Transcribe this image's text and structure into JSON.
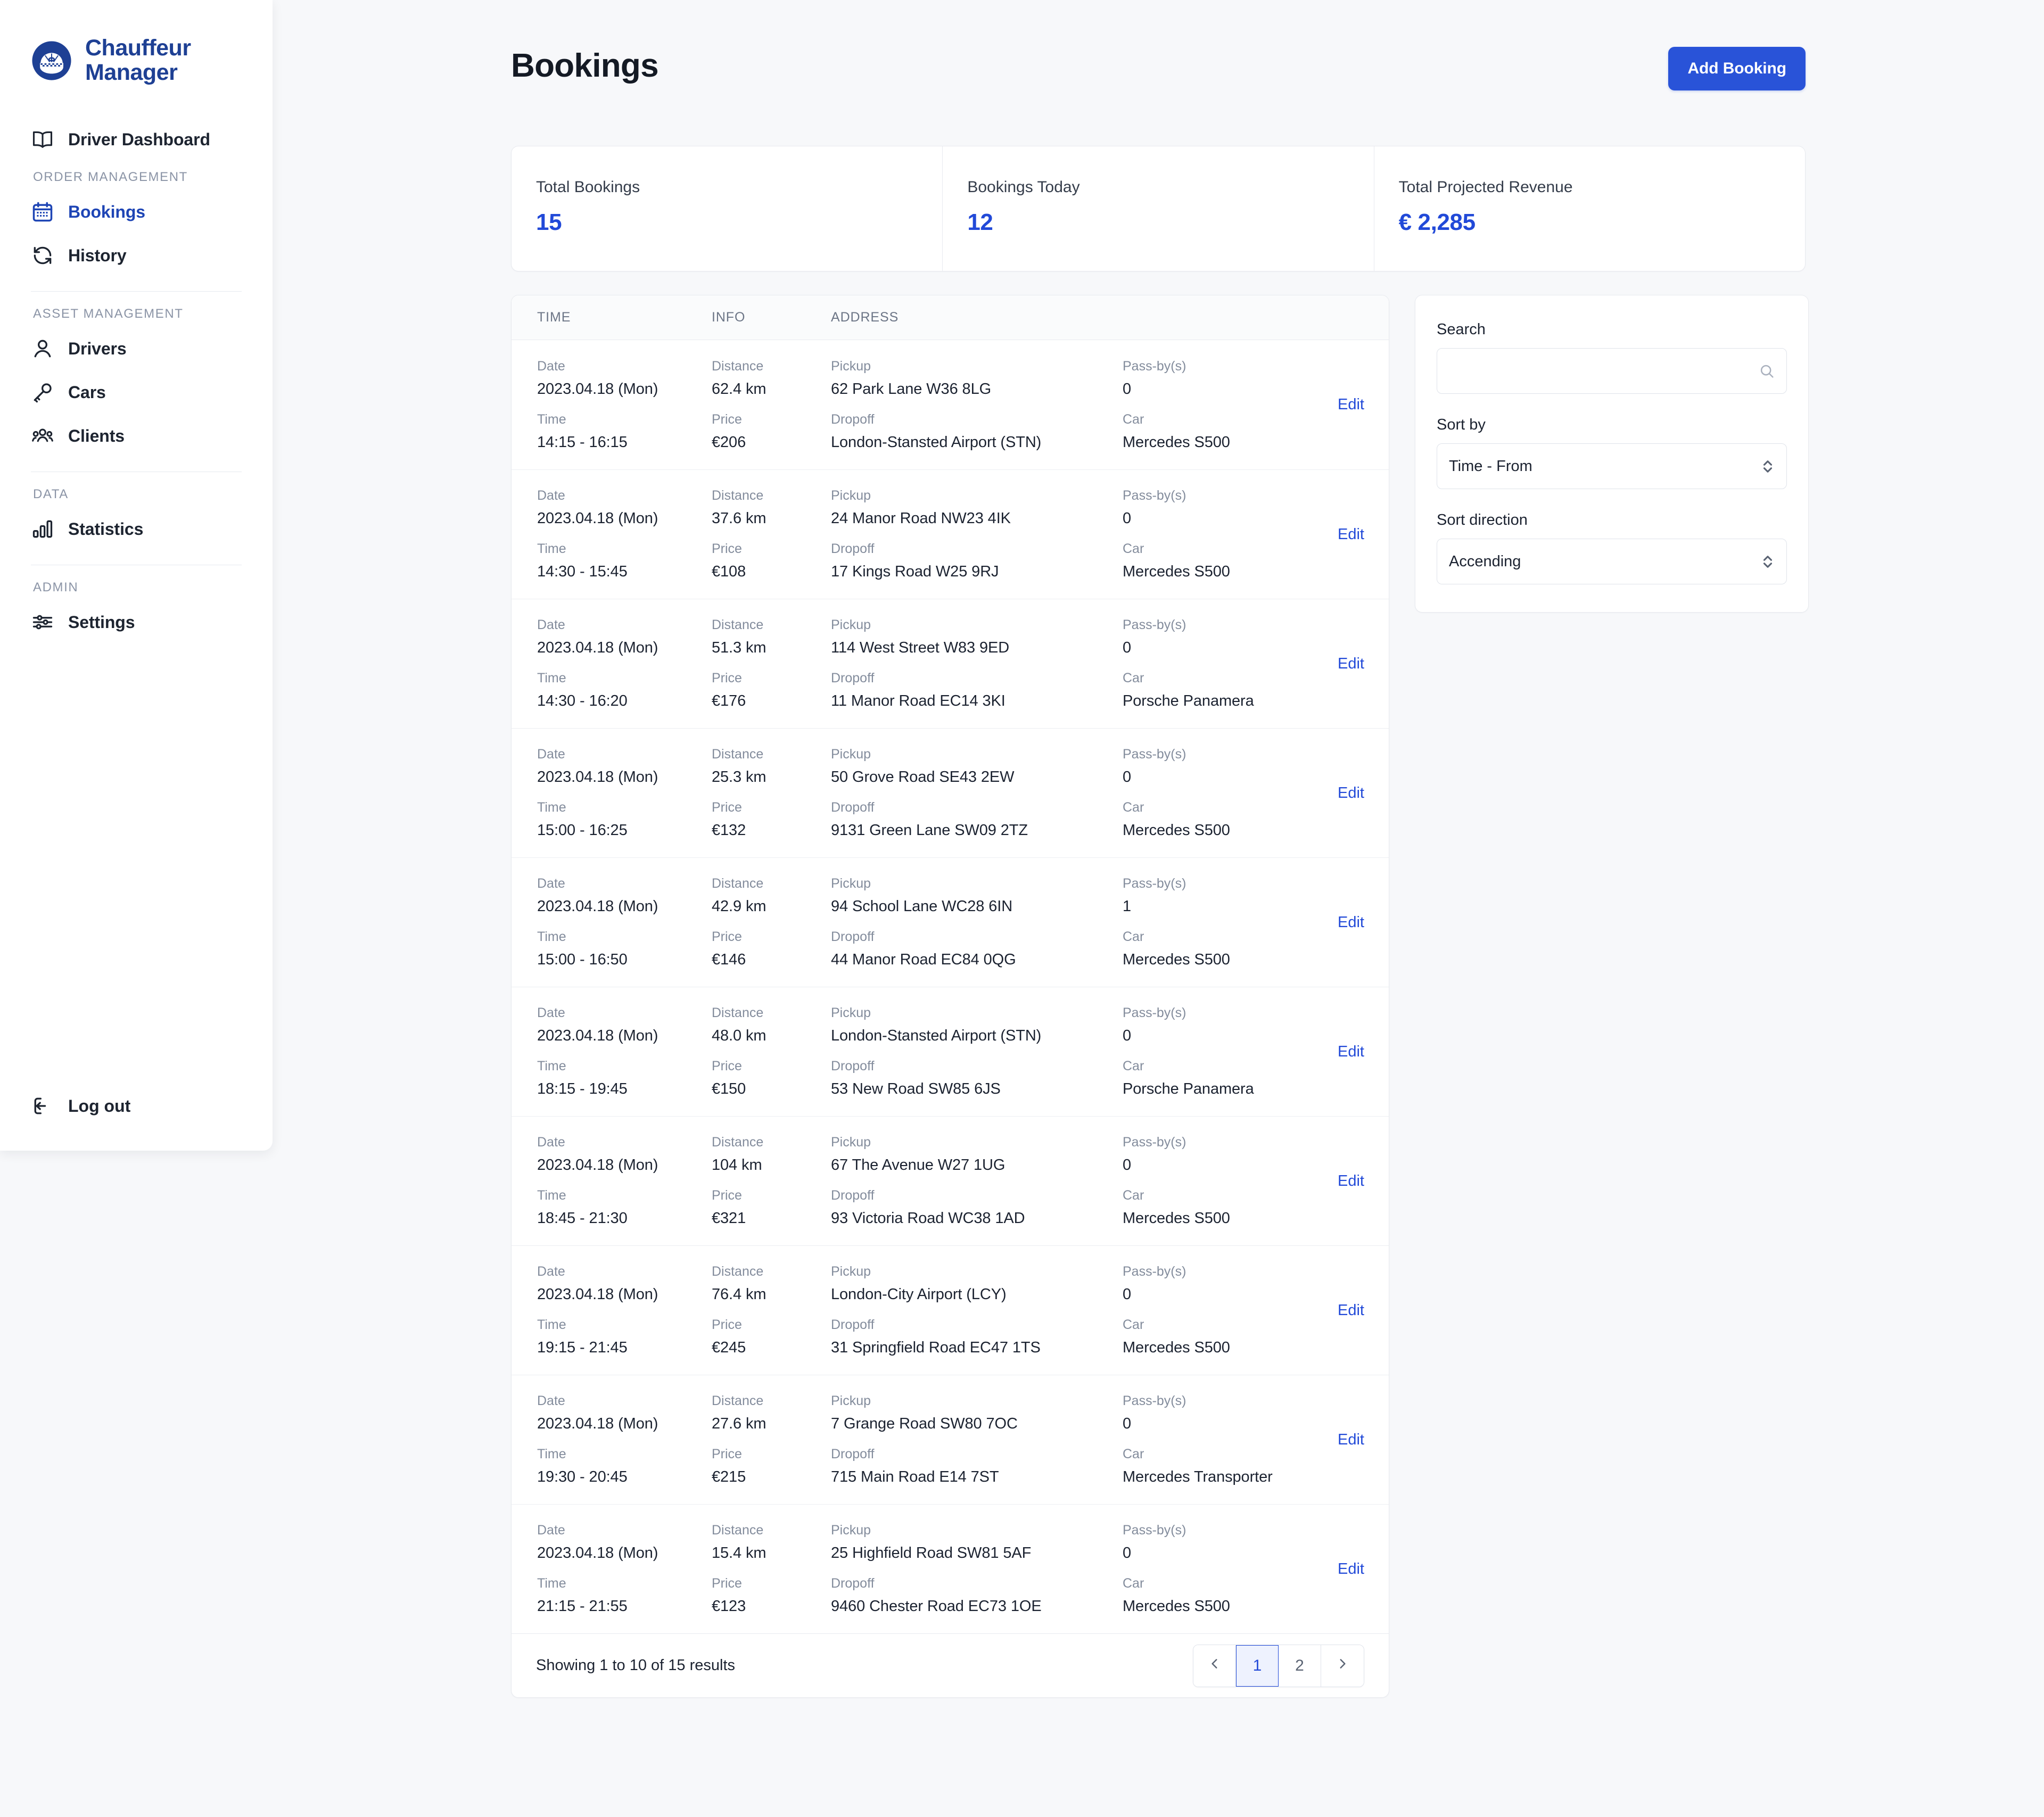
{
  "brand": {
    "line1": "Chauffeur",
    "line2": "Manager",
    "logo_icon": "chauffeur-cap-logo"
  },
  "sidebar": {
    "top_item": {
      "label": "Driver Dashboard",
      "icon": "book-open-icon"
    },
    "sections": [
      {
        "label": "ORDER MANAGEMENT",
        "items": [
          {
            "label": "Bookings",
            "icon": "calendar-icon",
            "active": true
          },
          {
            "label": "History",
            "icon": "refresh-cycle-icon",
            "active": false
          }
        ]
      },
      {
        "label": "ASSET MANAGEMENT",
        "items": [
          {
            "label": "Drivers",
            "icon": "user-icon",
            "active": false
          },
          {
            "label": "Cars",
            "icon": "key-icon",
            "active": false
          },
          {
            "label": "Clients",
            "icon": "users-group-icon",
            "active": false
          }
        ]
      },
      {
        "label": "DATA",
        "items": [
          {
            "label": "Statistics",
            "icon": "bar-chart-icon",
            "active": false
          }
        ]
      },
      {
        "label": "ADMIN",
        "items": [
          {
            "label": "Settings",
            "icon": "sliders-icon",
            "active": false
          }
        ]
      }
    ],
    "logout": {
      "label": "Log out",
      "icon": "logout-arrow-icon"
    }
  },
  "header": {
    "title": "Bookings",
    "add_button": "Add Booking"
  },
  "stats": [
    {
      "label": "Total Bookings",
      "value": "15"
    },
    {
      "label": "Bookings Today",
      "value": "12"
    },
    {
      "label": "Total Projected Revenue",
      "value": "€ 2,285"
    }
  ],
  "table": {
    "columns": [
      "TIME",
      "INFO",
      "ADDRESS"
    ],
    "field_labels": {
      "date": "Date",
      "time": "Time",
      "distance": "Distance",
      "price": "Price",
      "pickup": "Pickup",
      "dropoff": "Dropoff",
      "passby": "Pass-by(s)",
      "car": "Car"
    },
    "edit_label": "Edit",
    "rows": [
      {
        "date": "2023.04.18 (Mon)",
        "time": "14:15 - 16:15",
        "distance": "62.4 km",
        "price": "€206",
        "pickup": "62 Park Lane W36 8LG",
        "dropoff": "London-Stansted Airport (STN)",
        "passby": "0",
        "car": "Mercedes S500"
      },
      {
        "date": "2023.04.18 (Mon)",
        "time": "14:30 - 15:45",
        "distance": "37.6 km",
        "price": "€108",
        "pickup": "24 Manor Road NW23 4IK",
        "dropoff": "17 Kings Road W25 9RJ",
        "passby": "0",
        "car": "Mercedes S500"
      },
      {
        "date": "2023.04.18 (Mon)",
        "time": "14:30 - 16:20",
        "distance": "51.3 km",
        "price": "€176",
        "pickup": "114 West Street W83 9ED",
        "dropoff": "11 Manor Road EC14 3KI",
        "passby": "0",
        "car": "Porsche Panamera"
      },
      {
        "date": "2023.04.18 (Mon)",
        "time": "15:00 - 16:25",
        "distance": "25.3 km",
        "price": "€132",
        "pickup": "50 Grove Road SE43 2EW",
        "dropoff": "9131 Green Lane SW09 2TZ",
        "passby": "0",
        "car": "Mercedes S500"
      },
      {
        "date": "2023.04.18 (Mon)",
        "time": "15:00 - 16:50",
        "distance": "42.9 km",
        "price": "€146",
        "pickup": "94 School Lane WC28 6IN",
        "dropoff": "44 Manor Road EC84 0QG",
        "passby": "1",
        "car": "Mercedes S500"
      },
      {
        "date": "2023.04.18 (Mon)",
        "time": "18:15 - 19:45",
        "distance": "48.0 km",
        "price": "€150",
        "pickup": "London-Stansted Airport (STN)",
        "dropoff": "53 New Road SW85 6JS",
        "passby": "0",
        "car": "Porsche Panamera"
      },
      {
        "date": "2023.04.18 (Mon)",
        "time": "18:45 - 21:30",
        "distance": "104 km",
        "price": "€321",
        "pickup": "67 The Avenue W27 1UG",
        "dropoff": "93 Victoria Road WC38 1AD",
        "passby": "0",
        "car": "Mercedes S500"
      },
      {
        "date": "2023.04.18 (Mon)",
        "time": "19:15 - 21:45",
        "distance": "76.4 km",
        "price": "€245",
        "pickup": "London-City Airport (LCY)",
        "dropoff": "31 Springfield Road EC47 1TS",
        "passby": "0",
        "car": "Mercedes S500"
      },
      {
        "date": "2023.04.18 (Mon)",
        "time": "19:30 - 20:45",
        "distance": "27.6 km",
        "price": "€215",
        "pickup": "7 Grange Road SW80 7OC",
        "dropoff": "715 Main Road E14 7ST",
        "passby": "0",
        "car": "Mercedes Transporter"
      },
      {
        "date": "2023.04.18 (Mon)",
        "time": "21:15 - 21:55",
        "distance": "15.4 km",
        "price": "€123",
        "pickup": "25 Highfield Road SW81 5AF",
        "dropoff": "9460 Chester Road EC73 1OE",
        "passby": "0",
        "car": "Mercedes S500"
      }
    ],
    "footer": {
      "showing": "Showing 1 to 10 of 15 results",
      "pages": [
        "1",
        "2"
      ],
      "active_page": "1",
      "prev_icon": "chevron-left-icon",
      "next_icon": "chevron-right-icon"
    }
  },
  "filters": {
    "search_label": "Search",
    "search_value": "",
    "search_placeholder": "",
    "search_icon": "search-icon",
    "sort_by_label": "Sort by",
    "sort_by_value": "Time - From",
    "sort_direction_label": "Sort direction",
    "sort_direction_value": "Accending",
    "select_icon": "chevron-up-down-icon"
  },
  "colors": {
    "accent": "#2149d8",
    "brand_navy": "#1e4094",
    "page_bg": "#f7f8fa",
    "card_border": "#e8eaef",
    "muted_text": "#838c9c"
  }
}
